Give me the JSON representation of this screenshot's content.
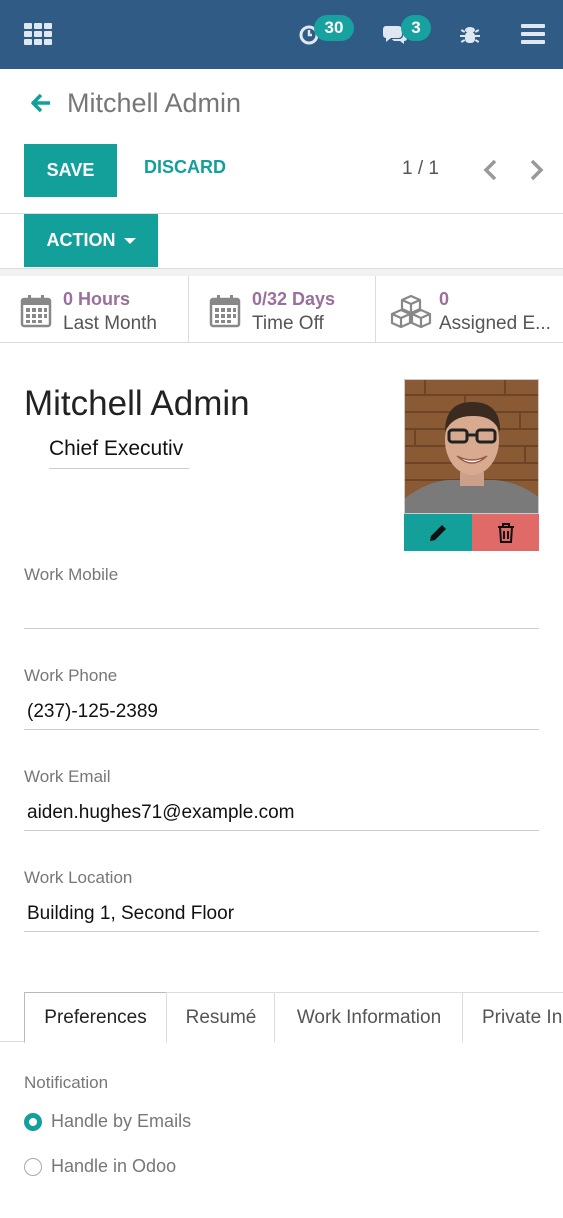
{
  "navbar": {
    "activity_count": "30",
    "message_count": "3",
    "colors": {
      "bar": "#2f5b85",
      "badge": "#17a2a0"
    },
    "icons": [
      "apps-grid-icon",
      "activity-clock-icon",
      "chat-icon",
      "bug-icon",
      "hamburger-menu-icon"
    ]
  },
  "breadcrumb": {
    "title": "Mitchell Admin"
  },
  "controls": {
    "save_label": "SAVE",
    "discard_label": "DISCARD",
    "pager": "1 / 1",
    "action_label": "ACTION"
  },
  "stats": [
    {
      "value": "0 Hours",
      "label": "Last Month",
      "icon": "calendar-icon"
    },
    {
      "value": "0/32 Days",
      "label": "Time Off",
      "icon": "calendar-icon"
    },
    {
      "value": "0",
      "label": "Assigned E...",
      "icon": "cubes-icon"
    }
  ],
  "employee": {
    "name": "Mitchell Admin",
    "job_title": "Chief Executiv"
  },
  "fields": {
    "work_mobile": {
      "label": "Work Mobile",
      "value": ""
    },
    "work_phone": {
      "label": "Work Phone",
      "value": "(237)-125-2389"
    },
    "work_email": {
      "label": "Work Email",
      "value": "aiden.hughes71@example.com"
    },
    "work_location": {
      "label": "Work Location",
      "value": "Building 1, Second Floor"
    }
  },
  "tabs": [
    {
      "label": "Preferences",
      "active": true
    },
    {
      "label": "Resumé",
      "active": false
    },
    {
      "label": "Work Information",
      "active": false
    },
    {
      "label": "Private In",
      "active": false
    }
  ],
  "notification": {
    "label": "Notification",
    "options": [
      {
        "label": "Handle by Emails",
        "checked": true
      },
      {
        "label": "Handle in Odoo",
        "checked": false
      }
    ]
  },
  "accent_color": "#13a09a",
  "danger_color": "#e06a67"
}
